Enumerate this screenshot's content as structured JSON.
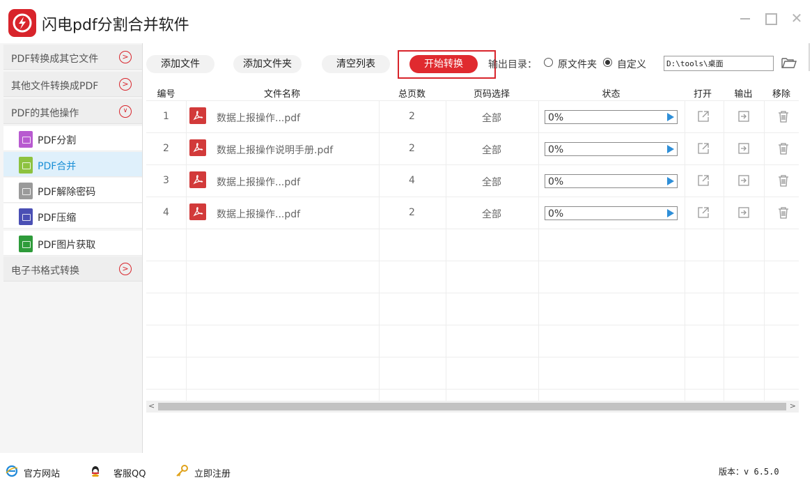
{
  "app": {
    "title": "闪电pdf分割合并软件",
    "window_controls": [
      "minimize-icon",
      "maximize-icon",
      "close-icon"
    ]
  },
  "sidebar": {
    "sections": [
      {
        "label": "PDF转换成其它文件",
        "expanded": false
      },
      {
        "label": "其他文件转换成PDF",
        "expanded": false
      },
      {
        "label": "PDF的其他操作",
        "expanded": true
      },
      {
        "label": "电子书格式转换",
        "expanded": false
      }
    ],
    "items": [
      {
        "label": "PDF分割",
        "icon": "split-icon",
        "color": "#b85ad0"
      },
      {
        "label": "PDF合并",
        "icon": "merge-icon",
        "color": "#8dc23f",
        "active": true
      },
      {
        "label": "PDF解除密码",
        "icon": "unlock-icon",
        "color": "#9a9a9a"
      },
      {
        "label": "PDF压缩",
        "icon": "compress-icon",
        "color": "#4a4fb4"
      },
      {
        "label": "PDF图片获取",
        "icon": "image-icon",
        "color": "#2e9b3a"
      }
    ]
  },
  "toolbar": {
    "add_file": "添加文件",
    "add_folder": "添加文件夹",
    "clear_list": "清空列表",
    "start": "开始转换",
    "output_label": "输出目录：",
    "radio_source": "原文件夹",
    "radio_custom": "自定义",
    "selected_output": "自定义",
    "output_path": "D:\\tools\\桌面"
  },
  "table": {
    "columns": [
      "编号",
      "文件名称",
      "总页数",
      "页码选择",
      "状态",
      "打开",
      "输出",
      "移除"
    ],
    "rows": [
      {
        "num": "1",
        "name": "数据上报操作...pdf",
        "pages": "2",
        "range": "全部",
        "progress": "0%"
      },
      {
        "num": "2",
        "name": "数据上报操作说明手册.pdf",
        "pages": "2",
        "range": "全部",
        "progress": "0%"
      },
      {
        "num": "3",
        "name": "数据上报操作...pdf",
        "pages": "4",
        "range": "全部",
        "progress": "0%"
      },
      {
        "num": "4",
        "name": "数据上报操作...pdf",
        "pages": "2",
        "range": "全部",
        "progress": "0%"
      }
    ]
  },
  "footer": {
    "official_site": "官方网站",
    "support": "客服QQ",
    "register": "立即注册",
    "version_label": "版本：",
    "version": "v 6.5.0"
  },
  "colors": {
    "accent_red": "#e02a2f",
    "accent_blue": "#1a8fd6",
    "progress_play": "#2f8fd8"
  }
}
